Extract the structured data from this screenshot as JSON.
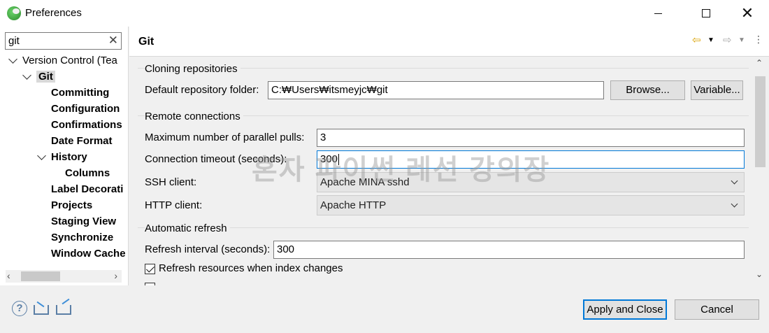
{
  "window": {
    "title": "Preferences",
    "close_glyph": "✕"
  },
  "sidebar": {
    "filter_value": "git",
    "clear_glyph": "✕",
    "tree": [
      {
        "label": "Version Control (Tea",
        "level": 0,
        "expanded": true,
        "bold": false
      },
      {
        "label": "Git",
        "level": 1,
        "expanded": true,
        "bold": true,
        "selected": true
      },
      {
        "label": "Committing",
        "level": 2,
        "bold": true
      },
      {
        "label": "Configuration",
        "level": 2,
        "bold": true
      },
      {
        "label": "Confirmations",
        "level": 2,
        "bold": true
      },
      {
        "label": "Date Format",
        "level": 2,
        "bold": true
      },
      {
        "label": "History",
        "level": 2,
        "expanded": true,
        "bold": true
      },
      {
        "label": "Columns",
        "level": 3,
        "bold": true
      },
      {
        "label": "Label Decorati",
        "level": 2,
        "bold": true
      },
      {
        "label": "Projects",
        "level": 2,
        "bold": true
      },
      {
        "label": "Staging View",
        "level": 2,
        "bold": true
      },
      {
        "label": "Synchronize",
        "level": 2,
        "bold": true
      },
      {
        "label": "Window Cache",
        "level": 2,
        "bold": true
      }
    ]
  },
  "main": {
    "title": "Git",
    "cloning": {
      "title": "Cloning repositories",
      "default_folder_label": "Default repository folder:",
      "default_folder_value": "C:₩Users₩itsmeyjc₩git",
      "browse_button": "Browse...",
      "variable_button": "Variable..."
    },
    "remote": {
      "title": "Remote connections",
      "max_pulls_label": "Maximum number of parallel pulls:",
      "max_pulls_value": "3",
      "timeout_label": "Connection timeout (seconds):",
      "timeout_value": "300",
      "ssh_label": "SSH client:",
      "ssh_value": "Apache MINA sshd",
      "http_label": "HTTP client:",
      "http_value": "Apache HTTP"
    },
    "refresh": {
      "title": "Automatic refresh",
      "interval_label": "Refresh interval (seconds):",
      "interval_value": "300",
      "refresh_on_index_label": "Refresh resources when index changes",
      "refresh_on_index_checked": true
    },
    "watermark": "혼자 파이썬 레선 강의장"
  },
  "footer": {
    "apply_close_button": "Apply and Close",
    "cancel_button": "Cancel"
  }
}
